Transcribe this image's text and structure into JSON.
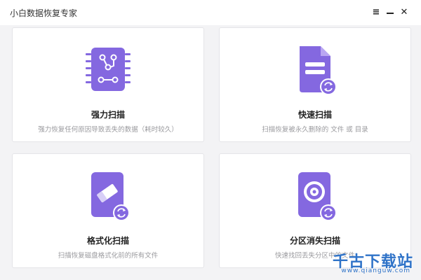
{
  "window": {
    "title": "小白数据恢复专家",
    "menu_icon": "menu-icon",
    "minimize_icon": "minimize-icon",
    "close_icon": "close-icon"
  },
  "colors": {
    "accent": "#8468e0",
    "accent_light": "#b9a6f2",
    "background": "#f3f3f5"
  },
  "cards": [
    {
      "title": "强力扫描",
      "desc": "强力恢复任何原因导致丢失的数据（耗时较久）",
      "icon": "circuit-chip-icon"
    },
    {
      "title": "快速扫描",
      "desc": "扫描恢复被永久删除的 文件 或 目录",
      "icon": "document-restore-icon"
    },
    {
      "title": "格式化扫描",
      "desc": "扫描恢复磁盘格式化前的所有文件",
      "icon": "eraser-drive-icon"
    },
    {
      "title": "分区消失扫描",
      "desc": "快速找回丢失分区中的文件",
      "icon": "disk-partition-icon"
    }
  ],
  "watermark": {
    "text": "千古下载站",
    "url": "www.qianguw.com"
  }
}
